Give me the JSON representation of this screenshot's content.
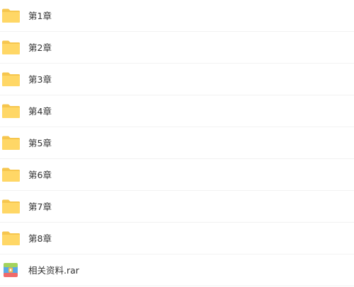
{
  "items": [
    {
      "name": "第1章",
      "icon": "folder-icon"
    },
    {
      "name": "第2章",
      "icon": "folder-icon"
    },
    {
      "name": "第3章",
      "icon": "folder-icon"
    },
    {
      "name": "第4章",
      "icon": "folder-icon"
    },
    {
      "name": "第5章",
      "icon": "folder-icon"
    },
    {
      "name": "第6章",
      "icon": "folder-icon"
    },
    {
      "name": "第7章",
      "icon": "folder-icon"
    },
    {
      "name": "第8章",
      "icon": "folder-icon"
    },
    {
      "name": "相关资料.rar",
      "icon": "rar-archive-icon"
    }
  ],
  "colors": {
    "folder_back": "#f6c64e",
    "folder_front": "#ffd766",
    "separator": "#f2f2f2",
    "text": "#333333"
  }
}
